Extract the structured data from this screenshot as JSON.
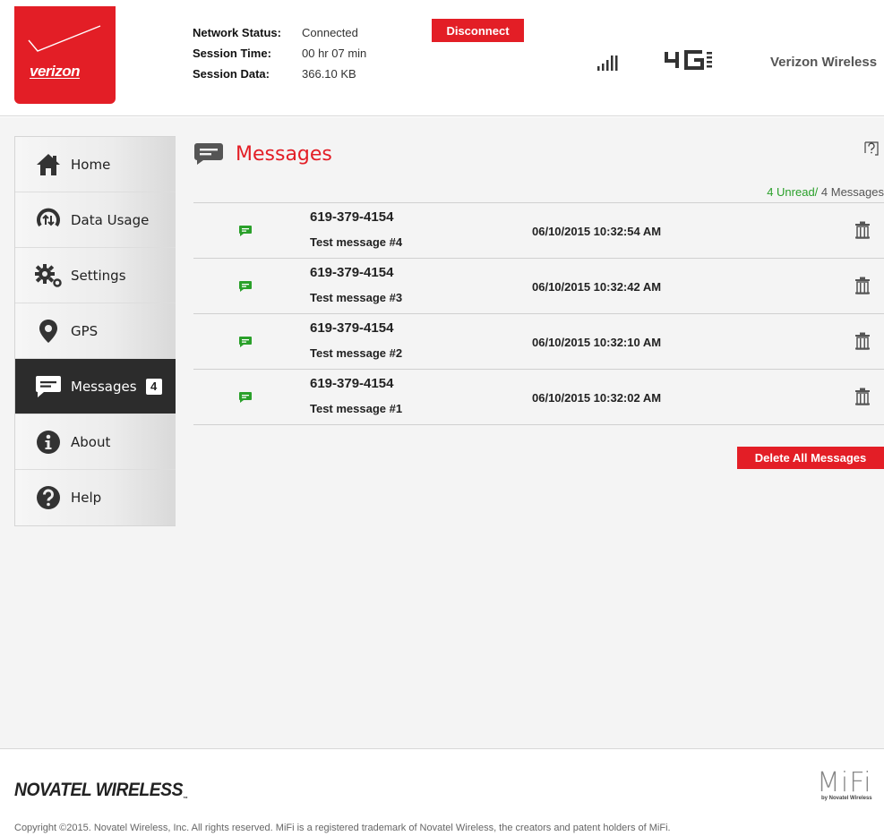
{
  "header": {
    "brand": "verizon",
    "status": [
      {
        "label": "Network Status:",
        "value": "Connected"
      },
      {
        "label": "Session Time:",
        "value": "00 hr 07 min"
      },
      {
        "label": "Session Data:",
        "value": "366.10 KB"
      }
    ],
    "disconnect_label": "Disconnect",
    "network_type": "4G",
    "network_sub": "LTE",
    "carrier": "Verizon Wireless"
  },
  "sidebar": {
    "items": [
      {
        "label": "Home",
        "icon": "home-icon"
      },
      {
        "label": "Data Usage",
        "icon": "data-usage-icon"
      },
      {
        "label": "Settings",
        "icon": "gear-icon"
      },
      {
        "label": "GPS",
        "icon": "map-pin-icon"
      },
      {
        "label": "Messages",
        "icon": "message-icon",
        "badge": "4",
        "active": true
      },
      {
        "label": "About",
        "icon": "info-icon"
      },
      {
        "label": "Help",
        "icon": "question-icon"
      }
    ]
  },
  "main": {
    "title": "Messages",
    "unread_text": "4 Unread/",
    "total_text": " 4 Messages",
    "messages": [
      {
        "number": "619-379-4154",
        "text": "Test message #4",
        "date": "06/10/2015 10:32:54 AM"
      },
      {
        "number": "619-379-4154",
        "text": "Test message #3",
        "date": "06/10/2015 10:32:42 AM"
      },
      {
        "number": "619-379-4154",
        "text": "Test message #2",
        "date": "06/10/2015 10:32:10 AM"
      },
      {
        "number": "619-379-4154",
        "text": "Test message #1",
        "date": "06/10/2015 10:32:02 AM"
      }
    ],
    "delete_all_label": "Delete All Messages"
  },
  "footer": {
    "brand": "NOVATEL WIRELESS",
    "brand_tm": "™",
    "product": "MiFi",
    "product_sub": "by Novatel Wireless",
    "copyright": "Copyright ©2015. Novatel Wireless, Inc. All rights reserved. MiFi is a registered trademark of Novatel Wireless, the creators and patent holders of MiFi."
  },
  "colors": {
    "brand_red": "#e31e26",
    "unread_green": "#2aa02a",
    "active_nav": "#2c2c2c"
  }
}
